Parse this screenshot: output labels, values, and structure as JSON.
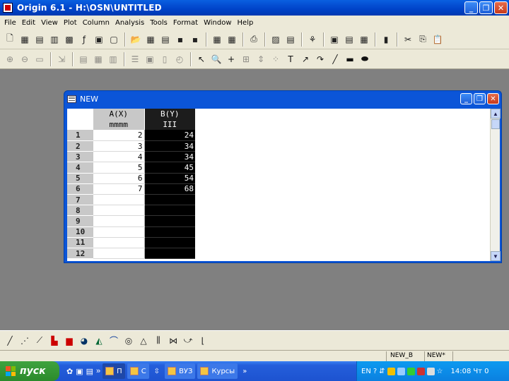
{
  "app": {
    "title": "Origin 6.1 - H:\\OSN\\UNTITLED"
  },
  "menu": [
    "File",
    "Edit",
    "View",
    "Plot",
    "Column",
    "Analysis",
    "Tools",
    "Format",
    "Window",
    "Help"
  ],
  "toolbar1": [
    "new-project-icon",
    "new-worksheet-icon",
    "new-excel-icon",
    "new-graph-icon",
    "new-matrix-icon",
    "new-function-icon",
    "new-layout-icon",
    "new-notes-icon",
    "open-icon",
    "open-template-icon",
    "open-excel-icon",
    "save-project-icon",
    "save-template-icon",
    "import-ascii-icon",
    "import-multiple-icon",
    "print-icon",
    "refresh-icon",
    "duplicate-icon",
    "results-log-icon",
    "code-builder-icon",
    "project-explorer-icon",
    "command-window-icon",
    "cut-icon",
    "copy-icon",
    "paste-icon"
  ],
  "toolbar2": [
    "zoom-in-icon",
    "zoom-out-icon",
    "whole-page-icon",
    "rescale-icon",
    "add-layer-icon",
    "merge-icon",
    "arrange-icon",
    "layer-tool-icon",
    "extract-icon",
    "anchor-icon",
    "pointer-icon",
    "zoom-tool-icon",
    "screen-reader-icon",
    "data-reader-icon",
    "data-selector-icon",
    "draw-data-icon",
    "text-tool-icon",
    "arrow-tool-icon",
    "curved-arrow-icon",
    "line-tool-icon",
    "rectangle-tool-icon",
    "circle-tool-icon"
  ],
  "child_window": {
    "title": "NEW",
    "columns": [
      {
        "header": "A(X)",
        "format": "mmmm"
      },
      {
        "header": "B(Y)",
        "format": "III"
      }
    ],
    "rows": [
      {
        "n": "1",
        "a": "2",
        "b": "24"
      },
      {
        "n": "2",
        "a": "3",
        "b": "34"
      },
      {
        "n": "3",
        "a": "4",
        "b": "34"
      },
      {
        "n": "4",
        "a": "5",
        "b": "45"
      },
      {
        "n": "5",
        "a": "6",
        "b": "54"
      },
      {
        "n": "6",
        "a": "7",
        "b": "68"
      },
      {
        "n": "7",
        "a": "",
        "b": ""
      },
      {
        "n": "8",
        "a": "",
        "b": ""
      },
      {
        "n": "9",
        "a": "",
        "b": ""
      },
      {
        "n": "10",
        "a": "",
        "b": ""
      },
      {
        "n": "11",
        "a": "",
        "b": ""
      },
      {
        "n": "12",
        "a": "",
        "b": ""
      }
    ]
  },
  "toolbar3": [
    "line-plot-icon",
    "scatter-plot-icon",
    "line-symbol-plot-icon",
    "column-plot-icon",
    "stacked-column-icon",
    "pie-chart-icon",
    "area-plot-icon",
    "polar-plot-icon",
    "ternary-plot-icon",
    "triangle-plot-icon",
    "box-plot-icon",
    "multi-curve-icon",
    "vector-plot-icon",
    "template-library-icon"
  ],
  "status": {
    "left": "NEW_B",
    "right": "NEW*"
  },
  "taskbar": {
    "start_label": "пуск",
    "tasks": [
      {
        "label": "П",
        "active": true
      },
      {
        "label": "С",
        "active": false
      },
      {
        "label": "ВУЗ",
        "active": false
      },
      {
        "label": "Курсы",
        "active": false
      }
    ],
    "lang": "EN",
    "time": "14:08",
    "day": "Чт 0"
  },
  "colors": {
    "title_blue": "#0042c8",
    "face": "#ece9d8",
    "workspace": "#808080",
    "selected_column": "#000000"
  }
}
